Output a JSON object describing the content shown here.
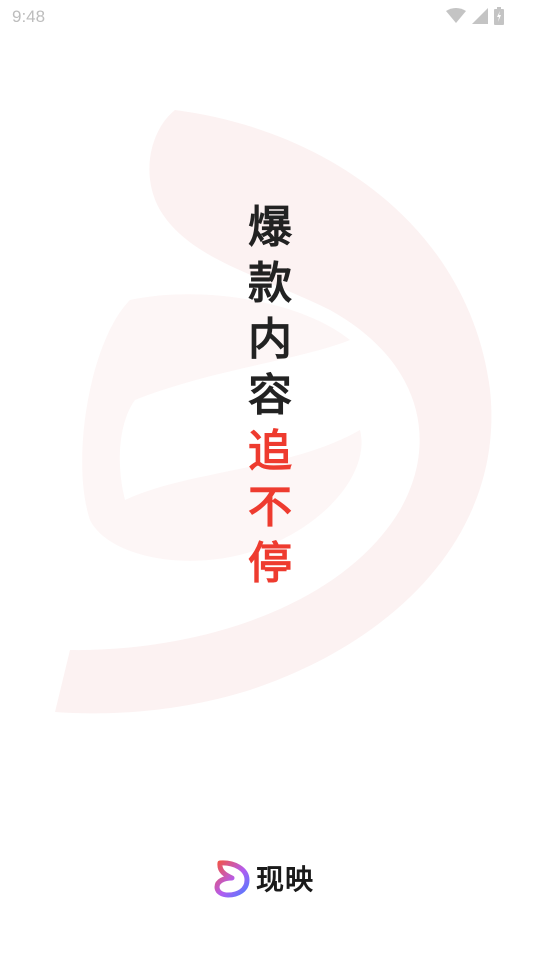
{
  "status_bar": {
    "time": "9:48",
    "icons": [
      "wifi-icon",
      "cellular-signal-icon",
      "battery-charging-icon"
    ]
  },
  "slogan": {
    "dark_chars": [
      "爆",
      "款",
      "内",
      "容"
    ],
    "red_chars": [
      "追",
      "不",
      "停"
    ]
  },
  "brand": {
    "name": "现映",
    "logo_icon": "app-logo-icon"
  },
  "colors": {
    "accent_red": "#ee3b2f",
    "text_dark": "#222222",
    "watermark": "#fbefef",
    "logo_gradient": [
      "#f0544a",
      "#b35cf0",
      "#4d7cff"
    ]
  }
}
